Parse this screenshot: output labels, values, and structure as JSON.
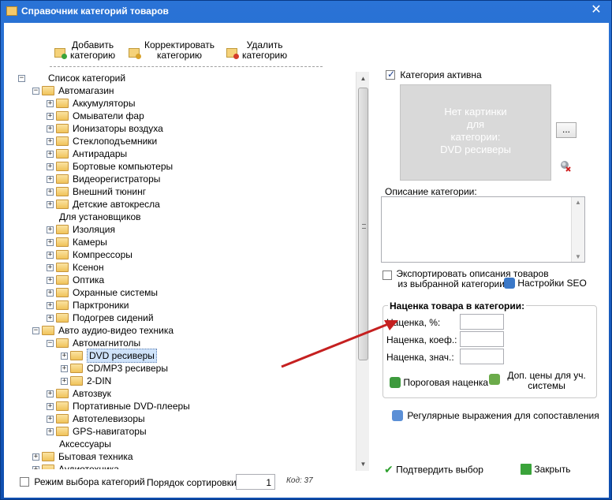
{
  "window": {
    "title": "Справочник категорий товаров",
    "close_glyph": "✕"
  },
  "toolbar": {
    "add_label_1": "Добавить",
    "add_label_2": "категорию",
    "edit_label_1": "Корректировать",
    "edit_label_2": "категорию",
    "delete_label_1": "Удалить",
    "delete_label_2": "категорию"
  },
  "tree": {
    "root": "Список категорий",
    "nodes": [
      "Автомагазин",
      "Аккумуляторы",
      "Омыватели фар",
      "Ионизаторы воздуха",
      "Стеклоподъемники",
      "Антирадары",
      "Бортовые компьютеры",
      "Видеорегистраторы",
      "Внешний тюнинг",
      "Детские автокресла",
      "Для установщиков",
      "Изоляция",
      "Камеры",
      "Компрессоры",
      "Ксенон",
      "Оптика",
      "Охранные системы",
      "Парктроники",
      "Подогрев сидений",
      "Авто аудио-видео техника",
      "Автомагнитолы",
      "DVD ресиверы",
      "CD/MP3 ресиверы",
      "2-DIN",
      "Автозвук",
      "Портативные DVD-плееры",
      "Автотелевизоры",
      "GPS-навигаторы",
      "Аксессуары",
      "Бытовая техника",
      "Аудиотехника"
    ]
  },
  "bottom_left": {
    "select_mode_label": "Режим выбора категорий",
    "sort_order_label": "Порядок сортировки:",
    "sort_order_value": "1",
    "code_label": "Код: 37"
  },
  "right": {
    "active_label": "Категория активна",
    "no_picture_1": "Нет картинки",
    "no_picture_2": "для",
    "no_picture_3": "категории:",
    "no_picture_4": "DVD ресиверы",
    "dots_label": "...",
    "description_label": "Описание категории:",
    "export_label_1": "Экспортировать описания товаров",
    "export_label_2": "из выбранной категории",
    "seo_label": "Настройки SEO",
    "markup_group_title": "Наценка товара в категории:",
    "markup_percent_label": "Наценка, %:",
    "markup_coef_label": "Наценка, коеф.:",
    "markup_value_label": "Наценка, знач.:",
    "threshold_label": "Пороговая наценка",
    "extra_prices_label_1": "Доп. цены для уч.",
    "extra_prices_label_2": "системы",
    "regex_label": "Регулярные выражения для сопоставления",
    "confirm_label": "Подтвердить выбор",
    "close_label": "Закрыть"
  }
}
